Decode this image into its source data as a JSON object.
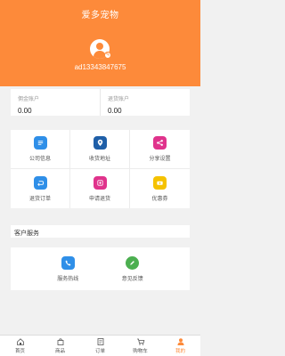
{
  "header": {
    "title": "爱多宠物",
    "user_id": "ad13343847675",
    "background_color": "#fd8a3a"
  },
  "balances": [
    {
      "label": "佣金账户",
      "value": "0.00"
    },
    {
      "label": "退货账户",
      "value": "0.00"
    }
  ],
  "menu": [
    {
      "label": "公司信息",
      "icon": "document-icon",
      "color": "#2f8fe8"
    },
    {
      "label": "收货地址",
      "icon": "location-pin-icon",
      "color": "#1f5fa8"
    },
    {
      "label": "分享设置",
      "icon": "share-icon",
      "color": "#e0338c"
    },
    {
      "label": "退货订单",
      "icon": "return-arrow-icon",
      "color": "#2f8fe8"
    },
    {
      "label": "申请退货",
      "icon": "return-request-icon",
      "color": "#e0338c"
    },
    {
      "label": "优惠券",
      "icon": "coupon-icon",
      "color": "#f5c200"
    }
  ],
  "service": {
    "title": "客户服务",
    "items": [
      {
        "label": "服务热线",
        "icon": "phone-icon",
        "color": "#2f8fe8"
      },
      {
        "label": "意见反馈",
        "icon": "pencil-icon",
        "color": "#4caf50"
      }
    ]
  },
  "tabbar": [
    {
      "label": "首页",
      "icon": "home-icon"
    },
    {
      "label": "商品",
      "icon": "bag-icon"
    },
    {
      "label": "订单",
      "icon": "order-icon"
    },
    {
      "label": "购物车",
      "icon": "cart-icon"
    },
    {
      "label": "我的",
      "icon": "user-icon",
      "active": true
    }
  ]
}
